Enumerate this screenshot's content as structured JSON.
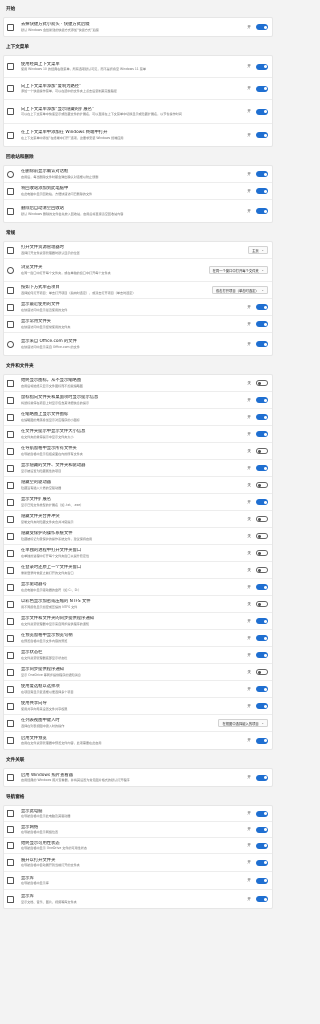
{
  "sections": [
    {
      "title": "开始",
      "rows": [
        {
          "icon": "grid-icon",
          "title": "去掉快捷方式小箭头 · 快捷方式后缀",
          "desc": "默认 Windows 会给新建的快捷方式添加“快捷方式”后缀",
          "state": "开",
          "on": true
        }
      ]
    },
    {
      "title": "上下文菜单",
      "rows": [
        {
          "icon": "menu-icon",
          "title": "使用经典上下文菜单",
          "desc": "使用 Windows 10 的经典右键菜单，所有选项默认可见，而不是折叠至 Windows 11 菜单",
          "state": "开",
          "on": true
        },
        {
          "icon": "link-icon",
          "title": "向上下文菜单添加“复制为路径”",
          "desc": "添加一个快捷操作菜单，可以在选中的文件夹上点击后复制其完整路径",
          "state": "开",
          "on": true
        },
        {
          "icon": "terminal-icon",
          "title": "向上下文菜单添加“显示隐藏的扩展名”",
          "desc": "可以在上下文菜单中快速显示或隐藏文件的扩展名，可以直接在上下文菜单中切换显示或隐藏扩展名，以节省操作时间",
          "state": "开",
          "on": true
        },
        {
          "icon": "window-icon",
          "title": "在上下文菜单中添加在 Windows 终端中打开",
          "desc": "在上下文菜单中添加“在终端中打开”选项，这要求安装 Windows 终端应用",
          "state": "开",
          "on": true
        }
      ]
    },
    {
      "title": "回收站和删除",
      "rows": [
        {
          "icon": "delete-icon",
          "title": "在删除前显示确认对话框",
          "desc": "启用后，每当删除文件时都会弹出确认对话框以防止误删",
          "state": "开",
          "on": true
        },
        {
          "icon": "trash-icon",
          "title": "将回收站添加到此电脑中",
          "desc": "在此电脑中显示回收站，方便快速访问已删除的文件",
          "state": "开",
          "on": true
        },
        {
          "icon": "folder-icon",
          "title": "删除后自动清空回收站",
          "desc": "默认 Windows 删除的文件会先放入回收站，启用后将直接清空回收站内容",
          "state": "开",
          "on": true
        }
      ]
    },
    {
      "title": "常规",
      "rows": [
        {
          "icon": "folder-icon",
          "title": "打开文件资源管理器时",
          "desc": "选择打开文件资源管理器时默认显示的位置",
          "dropdown": "主页"
        },
        {
          "icon": "search-icon",
          "title": "浏览文件夹",
          "desc": "在同一窗口中打开每个文件夹，或在单独的窗口中打开每个文件夹",
          "dropdown": "在同一个窗口中打开每个文件夹"
        },
        {
          "icon": "pointer-icon",
          "title": "按如下方式单击项目",
          "desc": "选择如何打开项目：单击打开项目（指向时选定），或双击打开项目（单击时选定）",
          "dropdown": "双击打开项目（单击时选定）"
        },
        {
          "icon": "file-icon",
          "title": "显示最近使用的文件",
          "desc": "在快速访问中显示最近使用的文件",
          "state": "开",
          "on": true
        },
        {
          "icon": "folder-icon",
          "title": "显示常用文件夹",
          "desc": "在快速访问中显示经常使用的文件夹",
          "state": "开",
          "on": true
        },
        {
          "icon": "cloud-icon",
          "title": "显示来自 Office.com 的文件",
          "desc": "在快速访问中显示来自 Office.com 的文件",
          "state": "开",
          "on": true
        }
      ]
    },
    {
      "title": "文件和文件夹",
      "rows": [
        {
          "icon": "file-icon",
          "title": "始终显示图标，从不显示缩略图",
          "desc": "启用后将始终只显示文件图标而不加载缩略图",
          "state": "关",
          "on": false
        },
        {
          "icon": "file-icon",
          "title": "鼠标指向文件夹和桌面项时显示提示信息",
          "desc": "将鼠标悬停在项目上时显示包含其详细信息的提示",
          "state": "开",
          "on": true
        },
        {
          "icon": "file-icon",
          "title": "在缩略图上显示文件图标",
          "desc": "在缩略图的角落叠加显示对应程序的小图标",
          "state": "开",
          "on": true
        },
        {
          "icon": "file-icon",
          "title": "在文件夹提示中显示文件大小信息",
          "desc": "在文件夹的悬停提示中显示文件夹大小",
          "state": "开",
          "on": true
        },
        {
          "icon": "folder-icon",
          "title": "在导航窗格中显示所有文件夹",
          "desc": "在导航窗格中显示包括桌面在内的所有文件夹",
          "state": "关",
          "on": false
        },
        {
          "icon": "file-icon",
          "title": "显示隐藏的文件、文件夹和驱动器",
          "desc": "显示被设置为隐藏属性的项目",
          "state": "开",
          "on": true
        },
        {
          "icon": "file-icon",
          "title": "隐藏空的驱动器",
          "desc": "隐藏没有插入介质的空驱动器",
          "state": "关",
          "on": false
        },
        {
          "icon": "file-icon",
          "title": "显示文件扩展名",
          "desc": "显示已知文件类型的扩展名（如 .txt、.exe）",
          "state": "开",
          "on": true
        },
        {
          "icon": "folder-icon",
          "title": "隐藏文件夹合并冲突",
          "desc": "复制文件夹时隐藏文件夹合并冲突提示",
          "state": "关",
          "on": false
        },
        {
          "icon": "file-icon",
          "title": "隐藏受保护的操作系统文件",
          "desc": "隐藏被标记为受保护的操作系统文件，建议保持启用",
          "state": "关",
          "on": false
        },
        {
          "icon": "file-icon",
          "title": "在单独的进程中打开文件夹窗口",
          "desc": "在单独的进程中打开每个文件夹窗口以提升稳定性",
          "state": "关",
          "on": false
        },
        {
          "icon": "file-icon",
          "title": "在登录时还原上一个文件夹窗口",
          "desc": "重新登录时恢复之前打开的文件夹窗口",
          "state": "关",
          "on": false
        },
        {
          "icon": "file-icon",
          "title": "显示驱动器号",
          "desc": "在此电脑中显示驱动器的盘符（如 C:、D:）",
          "state": "开",
          "on": true
        },
        {
          "icon": "file-icon",
          "title": "以彩色显示加密或压缩的 NTFS 文件",
          "desc": "用不同颜色显示加密或压缩的 NTFS 文件",
          "state": "关",
          "on": false
        },
        {
          "icon": "file-icon",
          "title": "显示文件和文件夹的同步提供程序通知",
          "desc": "在文件资源管理器中显示来自同步提供程序的通知",
          "state": "开",
          "on": true
        },
        {
          "icon": "file-icon",
          "title": "在预览窗格中显示预览句柄",
          "desc": "在预览窗格中显示文件内容的预览",
          "state": "开",
          "on": true
        },
        {
          "icon": "file-icon",
          "title": "显示状态栏",
          "desc": "在文件资源管理器底部显示状态栏",
          "state": "开",
          "on": true
        },
        {
          "icon": "file-icon",
          "title": "显示同步提供程序通知",
          "desc": "显示 OneDrive 等同步提供程序的通知消息",
          "state": "关",
          "on": false
        },
        {
          "icon": "file-icon",
          "title": "使用复选框以选择项",
          "desc": "在项目旁显示复选框以便选择多个项目",
          "state": "开",
          "on": true
        },
        {
          "icon": "file-icon",
          "title": "使用共享向导",
          "desc": "使用共享向导来设置文件共享权限",
          "state": "开",
          "on": true
        },
        {
          "icon": "file-icon",
          "title": "在列表视图中键入时",
          "desc": "选择在列表视图中键入时的操作",
          "dropdown": "在视图中选择键入的项目"
        },
        {
          "icon": "file-icon",
          "title": "启用文件预览",
          "desc": "启用在文件资源管理器中预览文件内容，此项需要在此启用",
          "state": "开",
          "on": true
        }
      ]
    },
    {
      "title": "文件关联",
      "rows": [
        {
          "icon": "file-icon",
          "title": "启用 Windows 照片查看器",
          "desc": "启用经典的 Windows 照片查看器，并将其设置为常见图片格式的默认打开程序",
          "state": "开",
          "on": true
        }
      ]
    },
    {
      "title": "导航窗格",
      "rows": [
        {
          "icon": "file-icon",
          "title": "显示此电脑",
          "desc": "在导航窗格中显示此电脑及其驱动器",
          "state": "开",
          "on": true
        },
        {
          "icon": "file-icon",
          "title": "显示网络",
          "desc": "在导航窗格中显示网络位置",
          "state": "开",
          "on": true
        },
        {
          "icon": "file-icon",
          "title": "始终显示可用性状态",
          "desc": "在导航窗格中显示 OneDrive 文件的可用性状态",
          "state": "开",
          "on": true
        },
        {
          "icon": "file-icon",
          "title": "展开以打开文件夹",
          "desc": "在导航窗格中自动展开到当前打开的文件夹",
          "state": "开",
          "on": true
        },
        {
          "icon": "file-icon",
          "title": "显示库",
          "desc": "在导航窗格中显示库",
          "state": "开",
          "on": true
        },
        {
          "icon": "file-icon",
          "title": "显示库",
          "desc": "显示文档、音乐、图片、视频等库文件夹",
          "state": "开",
          "on": true
        }
      ]
    }
  ]
}
